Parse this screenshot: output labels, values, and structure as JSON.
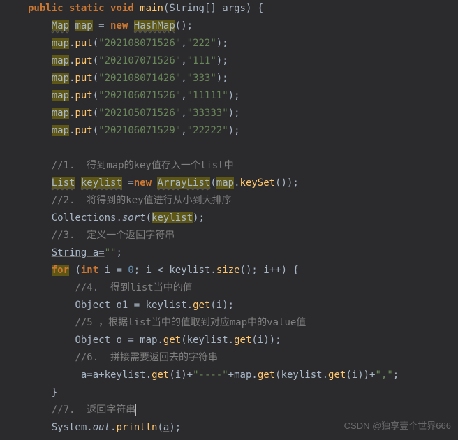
{
  "line1": {
    "public": "public",
    "static": "static",
    "void": "void",
    "main": "main",
    "String": "String",
    "args": "args"
  },
  "line2": {
    "Map": "Map",
    "map": "map",
    "equals": " = ",
    "new": "new",
    "HashMap": "HashMap",
    "paren": "();"
  },
  "puts": [
    {
      "map": "map",
      "put": "put",
      "k": "\"202108071526\"",
      "v": "\"222\""
    },
    {
      "map": "map",
      "put": "put",
      "k": "\"202107071526\"",
      "v": "\"111\""
    },
    {
      "map": "map",
      "put": "put",
      "k": "\"202108071426\"",
      "v": "\"333\""
    },
    {
      "map": "map",
      "put": "put",
      "k": "\"202106071526\"",
      "v": "\"11111\""
    },
    {
      "map": "map",
      "put": "put",
      "k": "\"202105071526\"",
      "v": "\"33333\""
    },
    {
      "map": "map",
      "put": "put",
      "k": "\"202106071529\"",
      "v": "\"22222\""
    }
  ],
  "cmt1": "//1.  得到map的key值存入一个list中",
  "line10": {
    "List": "List",
    "keylist": "keylist",
    "eq": " =",
    "new": "new",
    "ArrayList": "ArrayList",
    "open": "(",
    "map": "map",
    "keySet": "keySet",
    "close": "());"
  },
  "cmt2": "//2.  将得到的key值进行从小到大排序",
  "line12": {
    "Collections": "Collections",
    "sort": "sort",
    "keylist": "keylist"
  },
  "cmt3": "//3.  定义一个返回字符串",
  "line14": {
    "Stringa": "String a=",
    "empty": "\"\""
  },
  "line15": {
    "for": "for",
    "int": "int",
    "i": "i",
    "zero": "0",
    "lt": " < ",
    "keylist": "keylist",
    "size": "size",
    "inc": "++"
  },
  "cmt4": "//4.  得到list当中的值",
  "line17": {
    "Object": "Object",
    "o1": "o1",
    "eq": " = ",
    "keylist": "keylist",
    "get": "get",
    "i": "i"
  },
  "cmt5": "//5 ，根据list当中的值取到对应map中的value值",
  "line19": {
    "Object": "Object",
    "o": "o",
    "eq": " = ",
    "map": "map",
    "get": "get",
    "keylist": "keylist",
    "i": "i"
  },
  "cmt6": "//6.  拼接需要返回去的字符串",
  "line21": {
    "a": "a",
    "eq": "=",
    "plus": "+",
    "keylist": "keylist",
    "get": "get",
    "i": "i",
    "dash": "\"----\"",
    "map": "map",
    "comma": "\",\""
  },
  "rbrace": "}",
  "cmt7": "//7.  返回字符串",
  "line24": {
    "System": "System",
    "out": "out",
    "println": "println",
    "a": "a"
  },
  "watermark": "CSDN @独享壹个世界666"
}
